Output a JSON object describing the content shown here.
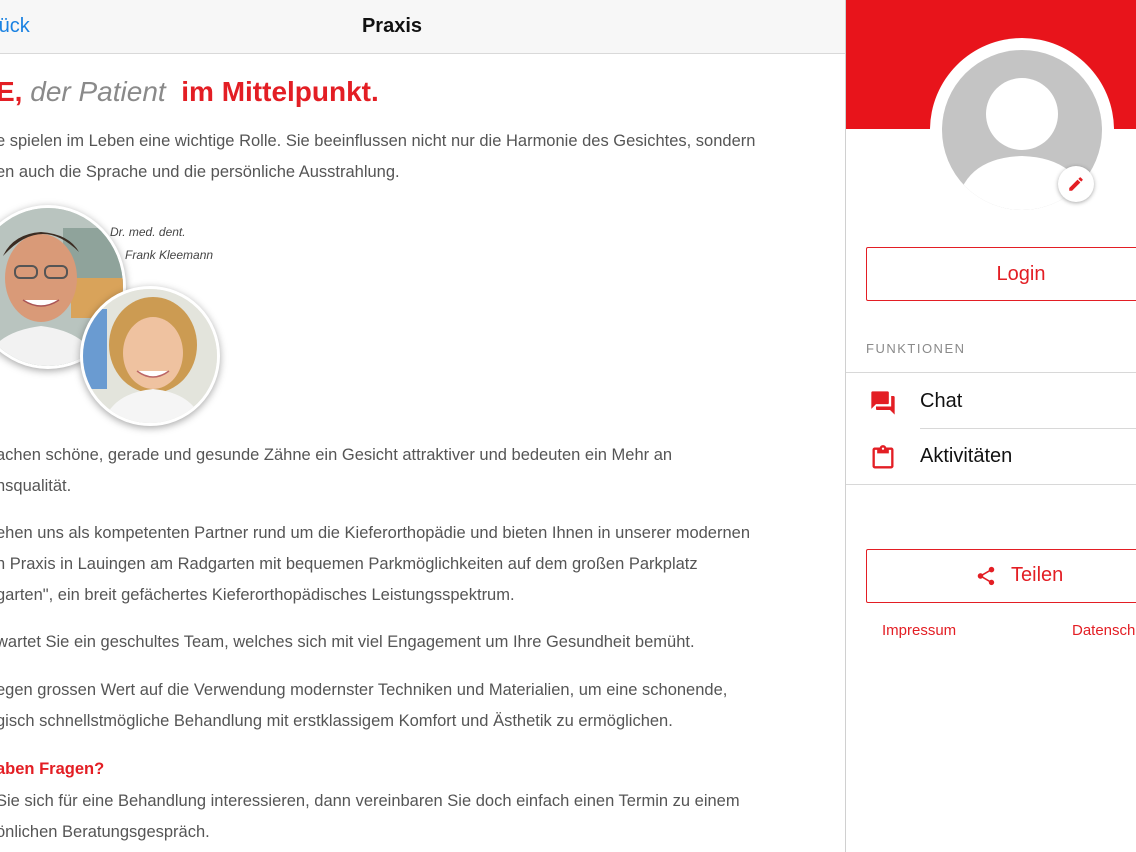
{
  "nav": {
    "back_label": "rück",
    "title": "Praxis"
  },
  "headline": {
    "part1": "E,",
    "part2": "der Patient",
    "part3": "im Mittelpunkt."
  },
  "intro": [
    "e spielen im Leben eine wichtige Rolle. Sie beeinflussen nicht nur die Harmonie des Gesichtes, sondern",
    "en auch die Sprache und die persönliche Ausstrahlung."
  ],
  "portrait_caption": {
    "line1": "Dr. med. dent.",
    "line2": "Frank Kleemann"
  },
  "paragraphs": [
    [
      "achen schöne, gerade und gesunde Zähne ein Gesicht attraktiver und bedeuten ein Mehr an",
      "nsqualität."
    ],
    [
      "ehen uns als kompetenten Partner rund um die Kieferorthopädie und bieten Ihnen in unserer modernen",
      "n Praxis in Lauingen am Radgarten mit bequemen Parkmöglichkeiten auf dem großen Parkplatz",
      "garten\", ein breit gefächertes Kieferorthopädisches Leistungsspektrum."
    ],
    [
      "wartet Sie ein geschultes Team, welches sich mit viel Engagement um Ihre Gesundheit bemüht."
    ],
    [
      "egen grossen Wert auf die Verwendung modernster Techniken und Materialien, um eine schonende,",
      "gisch schnellstmögliche Behandlung mit erstklassigem Komfort und Ästhetik zu ermöglichen."
    ]
  ],
  "questions": {
    "heading": "aben Fragen?",
    "lines": [
      "Sie sich für eine Behandlung interessieren, dann vereinbaren Sie doch einfach einen Termin zu einem",
      "önlichen Beratungsgespräch."
    ]
  },
  "sidebar": {
    "login_label": "Login",
    "section_label": "FUNKTIONEN",
    "menu": [
      {
        "label": "Chat",
        "icon": "chat-icon"
      },
      {
        "label": "Aktivitäten",
        "icon": "clipboard-icon"
      }
    ],
    "share_label": "Teilen",
    "impressum_label": "Impressum",
    "datenschutz_label": "Datensch"
  },
  "colors": {
    "accent": "#e31e24",
    "link": "#1a82e2",
    "header_red": "#e8141b"
  }
}
